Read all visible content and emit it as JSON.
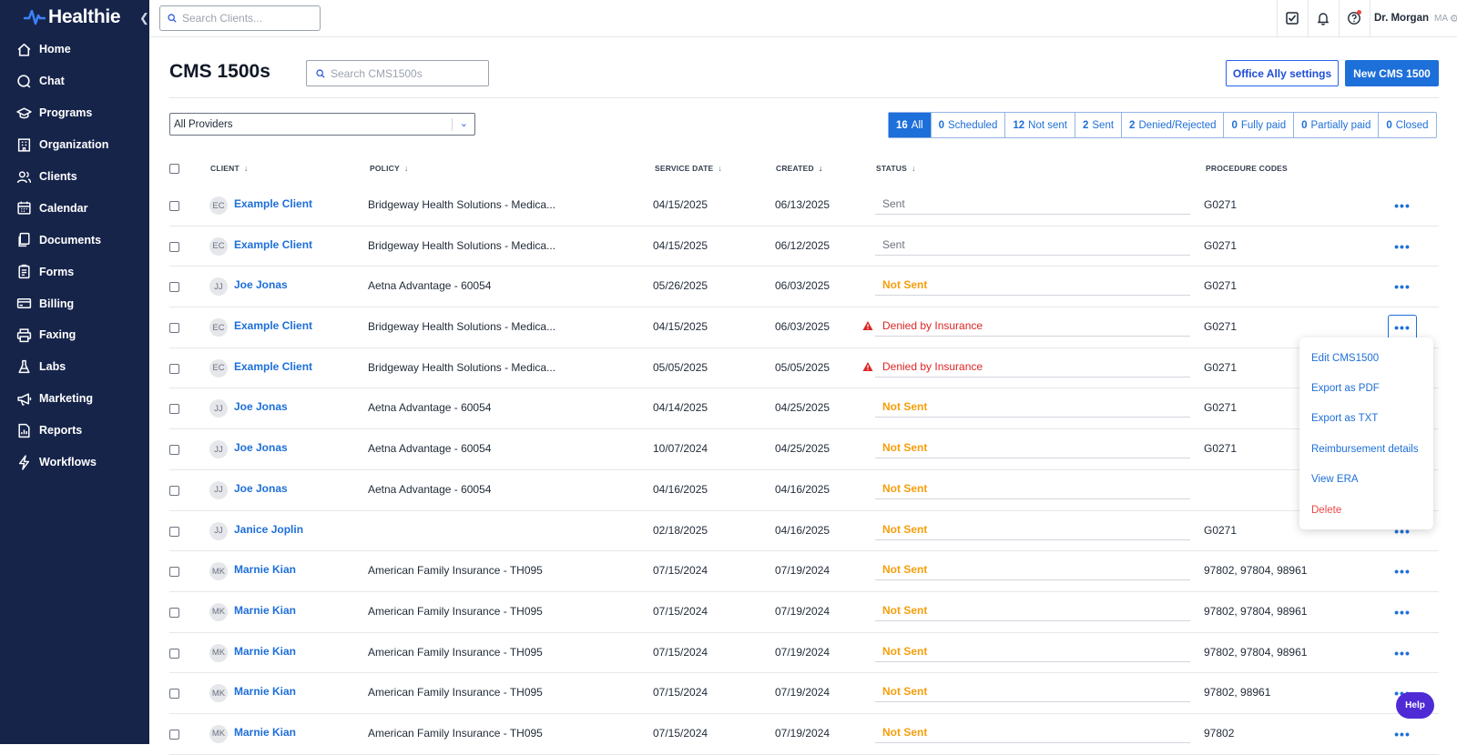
{
  "app": {
    "logo_text": "Healthie",
    "collapse_icon": "chevron-left-icon"
  },
  "sidebar": {
    "items": [
      {
        "label": "Home",
        "icon": "home-icon"
      },
      {
        "label": "Chat",
        "icon": "chat-icon"
      },
      {
        "label": "Programs",
        "icon": "graduation-cap-icon"
      },
      {
        "label": "Organization",
        "icon": "building-icon"
      },
      {
        "label": "Clients",
        "icon": "users-icon"
      },
      {
        "label": "Calendar",
        "icon": "calendar-icon"
      },
      {
        "label": "Documents",
        "icon": "documents-icon"
      },
      {
        "label": "Forms",
        "icon": "clipboard-icon"
      },
      {
        "label": "Billing",
        "icon": "credit-card-icon"
      },
      {
        "label": "Faxing",
        "icon": "printer-icon"
      },
      {
        "label": "Labs",
        "icon": "flask-icon"
      },
      {
        "label": "Marketing",
        "icon": "megaphone-icon"
      },
      {
        "label": "Reports",
        "icon": "report-icon"
      },
      {
        "label": "Workflows",
        "icon": "lightning-icon"
      }
    ]
  },
  "topbar": {
    "search_placeholder": "Search Clients...",
    "user_name": "Dr. Morgan",
    "user_initials": "MA"
  },
  "page": {
    "title": "CMS 1500s",
    "search_placeholder": "Search CMS1500s",
    "office_ally_label": "Office Ally settings",
    "new_label": "New CMS 1500",
    "provider_select": "All Providers"
  },
  "filters": [
    {
      "count": "16",
      "label": "All",
      "active": true
    },
    {
      "count": "0",
      "label": "Scheduled"
    },
    {
      "count": "12",
      "label": "Not sent"
    },
    {
      "count": "2",
      "label": "Sent"
    },
    {
      "count": "2",
      "label": "Denied/Rejected"
    },
    {
      "count": "0",
      "label": "Fully paid"
    },
    {
      "count": "0",
      "label": "Partially paid"
    },
    {
      "count": "0",
      "label": "Closed"
    }
  ],
  "table": {
    "headers": {
      "client": "CLIENT",
      "policy": "POLICY",
      "service_date": "SERVICE DATE",
      "created": "CREATED",
      "status": "STATUS",
      "procedure_codes": "PROCEDURE CODES"
    },
    "rows": [
      {
        "initials": "EC",
        "client": "Example Client",
        "policy": "Bridgeway Health Solutions - Medica...",
        "service_date": "04/15/2025",
        "created": "06/13/2025",
        "status": "Sent",
        "codes": "G0271"
      },
      {
        "initials": "EC",
        "client": "Example Client",
        "policy": "Bridgeway Health Solutions - Medica...",
        "service_date": "04/15/2025",
        "created": "06/12/2025",
        "status": "Sent",
        "codes": "G0271"
      },
      {
        "initials": "JJ",
        "client": "Joe Jonas",
        "policy": "Aetna Advantage - 60054",
        "service_date": "05/26/2025",
        "created": "06/03/2025",
        "status": "Not Sent",
        "codes": "G0271"
      },
      {
        "initials": "EC",
        "client": "Example Client",
        "policy": "Bridgeway Health Solutions - Medica...",
        "service_date": "04/15/2025",
        "created": "06/03/2025",
        "status": "Denied by Insurance",
        "codes": "G0271"
      },
      {
        "initials": "EC",
        "client": "Example Client",
        "policy": "Bridgeway Health Solutions - Medica...",
        "service_date": "05/05/2025",
        "created": "05/05/2025",
        "status": "Denied by Insurance",
        "codes": "G0271"
      },
      {
        "initials": "JJ",
        "client": "Joe Jonas",
        "policy": "Aetna Advantage - 60054",
        "service_date": "04/14/2025",
        "created": "04/25/2025",
        "status": "Not Sent",
        "codes": "G0271"
      },
      {
        "initials": "JJ",
        "client": "Joe Jonas",
        "policy": "Aetna Advantage - 60054",
        "service_date": "10/07/2024",
        "created": "04/25/2025",
        "status": "Not Sent",
        "codes": "G0271"
      },
      {
        "initials": "JJ",
        "client": "Joe Jonas",
        "policy": "Aetna Advantage - 60054",
        "service_date": "04/16/2025",
        "created": "04/16/2025",
        "status": "Not Sent",
        "codes": ""
      },
      {
        "initials": "JJ",
        "client": "Janice Joplin",
        "policy": "",
        "service_date": "02/18/2025",
        "created": "04/16/2025",
        "status": "Not Sent",
        "codes": "G0271"
      },
      {
        "initials": "MK",
        "client": "Marnie Kian",
        "policy": "American Family Insurance - TH095",
        "service_date": "07/15/2024",
        "created": "07/19/2024",
        "status": "Not Sent",
        "codes": "97802, 97804, 98961"
      },
      {
        "initials": "MK",
        "client": "Marnie Kian",
        "policy": "American Family Insurance - TH095",
        "service_date": "07/15/2024",
        "created": "07/19/2024",
        "status": "Not Sent",
        "codes": "97802, 97804, 98961"
      },
      {
        "initials": "MK",
        "client": "Marnie Kian",
        "policy": "American Family Insurance - TH095",
        "service_date": "07/15/2024",
        "created": "07/19/2024",
        "status": "Not Sent",
        "codes": "97802, 97804, 98961"
      },
      {
        "initials": "MK",
        "client": "Marnie Kian",
        "policy": "American Family Insurance - TH095",
        "service_date": "07/15/2024",
        "created": "07/19/2024",
        "status": "Not Sent",
        "codes": "97802, 98961"
      },
      {
        "initials": "MK",
        "client": "Marnie Kian",
        "policy": "American Family Insurance - TH095",
        "service_date": "07/15/2024",
        "created": "07/19/2024",
        "status": "Not Sent",
        "codes": "97802"
      }
    ],
    "more_label": "•••"
  },
  "context_menu": {
    "items": [
      {
        "label": "Edit CMS1500"
      },
      {
        "label": "Export as PDF"
      },
      {
        "label": "Export as TXT"
      },
      {
        "label": "Reimbursement details"
      },
      {
        "label": "View ERA"
      },
      {
        "label": "Delete",
        "danger": true
      }
    ]
  },
  "help_label": "Help",
  "colors": {
    "sidebar_bg": "#16244a",
    "accent": "#1d6fd9",
    "not_sent": "#f59e0b",
    "denied": "#dc2626",
    "help_bg": "#4f2bd6"
  }
}
